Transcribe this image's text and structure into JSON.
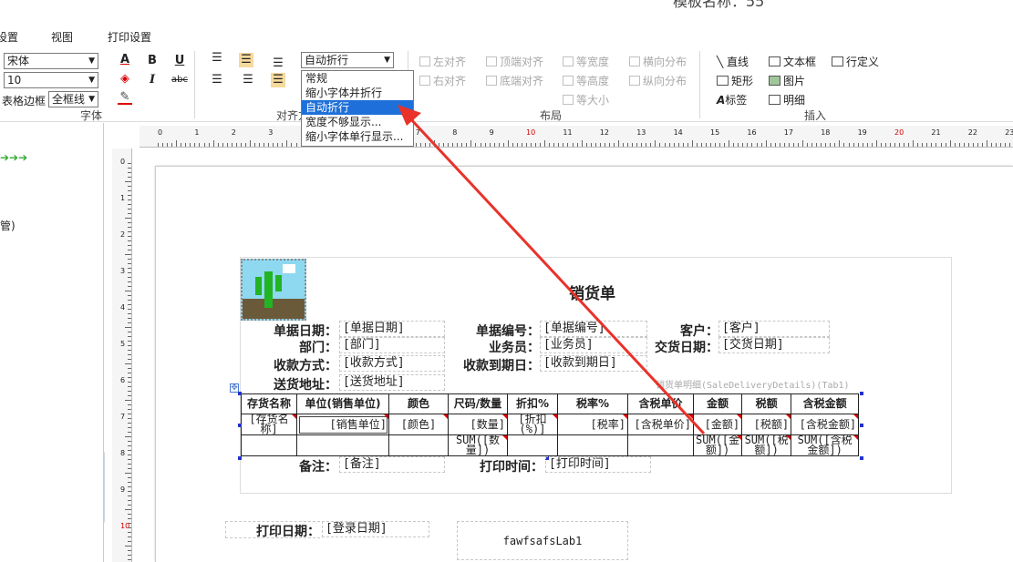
{
  "window": {
    "title_partial": "模板名称：55"
  },
  "menu": {
    "tab1": "设置",
    "tab2": "视图",
    "tab3": "打印设置"
  },
  "font": {
    "family": "宋体",
    "size": "10",
    "border_label": "表格边框",
    "border_value": "全框线",
    "group_label": "字体"
  },
  "format": {
    "text_color_label": "A",
    "bold": "B",
    "italic": "I",
    "underline": "U",
    "strike": "abc"
  },
  "align": {
    "group_label": "对齐方式",
    "wrap_value": "自动折行"
  },
  "wrap_options": [
    "常规",
    "缩小字体并折行",
    "自动折行",
    "宽度不够显示...",
    "缩小字体单行显示..."
  ],
  "layout": {
    "group_label": "布局",
    "items": [
      "左对齐",
      "顶端对齐",
      "等宽度",
      "横向分布",
      "右对齐",
      "底端对齐",
      "等高度",
      "纵向分布",
      "等大小"
    ]
  },
  "insert": {
    "group_label": "插入",
    "items": [
      "直线",
      "文本框",
      "矩形",
      "图片",
      "标签",
      "明细"
    ],
    "line_define": "行定义"
  },
  "left_panel": {
    "text": "管)"
  },
  "ruler": {
    "h_ticks": [
      "0",
      "1",
      "2",
      "3",
      "4",
      "5",
      "6",
      "7",
      "8",
      "9",
      "10",
      "11",
      "12",
      "13",
      "14",
      "15",
      "16",
      "17",
      "18",
      "19",
      "20",
      "21",
      "22",
      "23"
    ],
    "v_ticks": [
      "0",
      "1",
      "2",
      "3",
      "4",
      "5",
      "6",
      "7",
      "8",
      "9",
      "10"
    ]
  },
  "report": {
    "title": "销货单",
    "header_rows": [
      [
        {
          "label": "单据日期：",
          "field": "[单据日期]"
        },
        {
          "label": "单据编号：",
          "field": "[单据编号]"
        },
        {
          "label": "客户：",
          "field": "[客户]"
        }
      ],
      [
        {
          "label": "部门：",
          "field": "[部门]"
        },
        {
          "label": "业务员：",
          "field": "[业务员]"
        },
        {
          "label": "交货日期：",
          "field": "[交货日期]"
        }
      ],
      [
        {
          "label": "收款方式：",
          "field": "[收款方式]"
        },
        {
          "label": "收款到期日：",
          "field": "[收款到期日]"
        }
      ],
      [
        {
          "label": "送货地址：",
          "field": "[送货地址]"
        }
      ]
    ],
    "detail_caption": "销货单明细(SaleDeliveryDetails)(Tab1)",
    "columns": [
      "存货名称",
      "单位(销售单位)",
      "颜色",
      "尺码/数量",
      "折扣%",
      "税率%",
      "含税单价",
      "金额",
      "税额",
      "含税金额"
    ],
    "data_row": [
      "[存货名称]",
      "[销售单位]",
      "[颜色]",
      "[数量]",
      "[折扣(%)]",
      "[税率]",
      "[含税单价]",
      "[金额]",
      "[税额]",
      "[含税金额]"
    ],
    "sum_row": [
      "",
      "",
      "",
      "SUM([数量])",
      "",
      "",
      "",
      "SUM([金额])",
      "SUM([税额])",
      "SUM([含税金额])"
    ],
    "footer": [
      {
        "label": "备注：",
        "field": "[备注]"
      },
      {
        "label": "打印时间：",
        "field": "[打印时间]"
      }
    ],
    "page_footer": {
      "label": "打印日期：",
      "field": "[登录日期]",
      "lab": "fawfsafsLab1"
    }
  },
  "colors": {
    "arrow": "#e8322a",
    "highlight": "#1e6fd9",
    "accent_red": "#d00000"
  }
}
